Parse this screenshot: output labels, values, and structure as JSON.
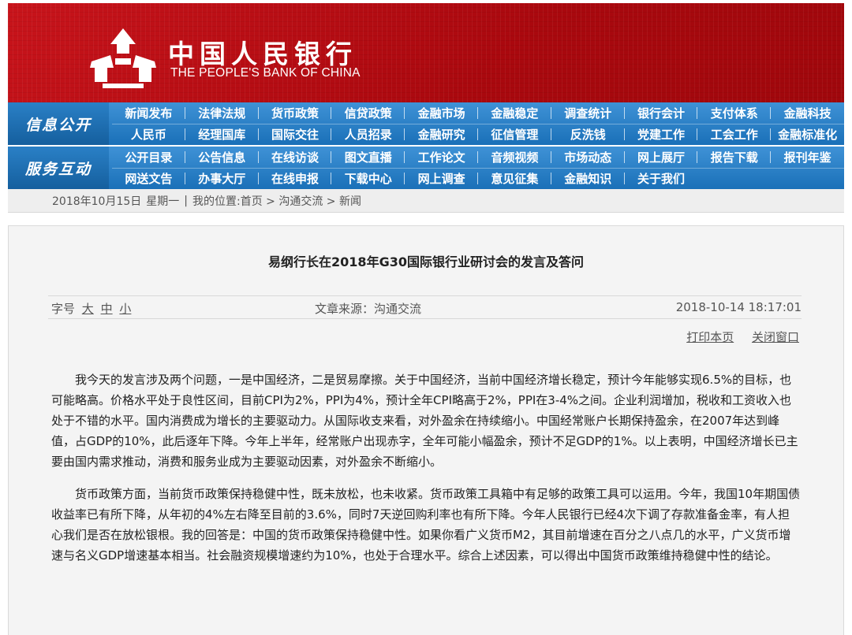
{
  "header": {
    "logo_cn": "中国人民银行",
    "logo_en": "THE PEOPLE'S BANK OF CHINA",
    "brand_color": "#b80b12"
  },
  "nav": {
    "categories": [
      {
        "label": "信息公开",
        "items": [
          "新闻发布",
          "法律法规",
          "货币政策",
          "信贷政策",
          "金融市场",
          "金融稳定",
          "调查统计",
          "银行会计",
          "支付体系",
          "金融科技",
          "人民币",
          "经理国库",
          "国际交往",
          "人员招录",
          "金融研究",
          "征信管理",
          "反洗钱",
          "党建工作",
          "工会工作",
          "金融标准化"
        ]
      },
      {
        "label": "服务互动",
        "items": [
          "公开目录",
          "公告信息",
          "在线访谈",
          "图文直播",
          "工作论文",
          "音频视频",
          "市场动态",
          "网上展厅",
          "报告下载",
          "报刊年鉴",
          "网送文告",
          "办事大厅",
          "在线申报",
          "下载中心",
          "网上调查",
          "意见征集",
          "金融知识",
          "关于我们",
          "",
          ""
        ]
      }
    ]
  },
  "breadcrumb": {
    "date": "2018年10月15日",
    "weekday": "星期一",
    "separator": "|",
    "location": "我的位置:首页 > 沟通交流 > 新闻"
  },
  "article": {
    "title": "易纲行长在2018年G30国际银行业研讨会的发言及答问",
    "font_size_label": "字号",
    "font_sizes": [
      "大",
      "中",
      "小"
    ],
    "source": "文章来源：沟通交流",
    "datetime": "2018-10-14 18:17:01",
    "print_label": "打印本页",
    "close_label": "关闭窗口",
    "paragraphs": [
      "我今天的发言涉及两个问题，一是中国经济，二是贸易摩擦。关于中国经济，当前中国经济增长稳定，预计今年能够实现6.5%的目标，也可能略高。价格水平处于良性区间，目前CPI为2%，PPI为4%，预计全年CPI略高于2%，PPI在3-4%之间。企业利润增加，税收和工资收入也处于不错的水平。国内消费成为增长的主要驱动力。从国际收支来看，对外盈余在持续缩小。中国经常账户长期保持盈余，在2007年达到峰值，占GDP的10%，此后逐年下降。今年上半年，经常账户出现赤字，全年可能小幅盈余，预计不足GDP的1%。以上表明，中国经济增长已主要由国内需求推动，消费和服务业成为主要驱动因素，对外盈余不断缩小。",
      "货币政策方面，当前货币政策保持稳健中性，既未放松，也未收紧。货币政策工具箱中有足够的政策工具可以运用。今年，我国10年期国债收益率已有所下降，从年初的4%左右降至目前的3.6%，同时7天逆回购利率也有所下降。今年人民银行已经4次下调了存款准备金率，有人担心我们是否在放松银根。我的回答是：中国的货币政策保持稳健中性。如果你看广义货币M2，其目前增速在百分之八点几的水平，广义货币增速与名义GDP增速基本相当。社会融资规模增速约为10%，也处于合理水平。综合上述因素，可以得出中国货币政策维持稳健中性的结论。"
    ]
  }
}
